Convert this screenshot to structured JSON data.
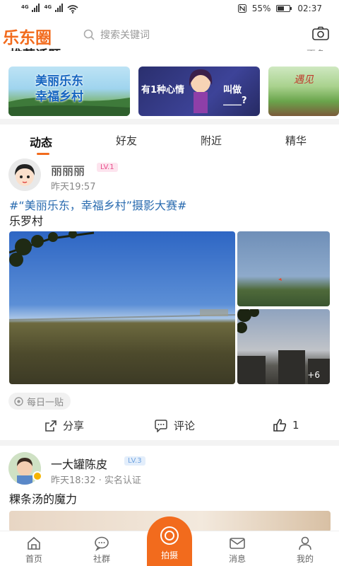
{
  "status_bar": {
    "network_left": "4G",
    "network_right": "4G",
    "battery": "55%",
    "time": "02:37"
  },
  "header": {
    "logo": "乐东圈",
    "search_placeholder": "搜索关键词",
    "icons": [
      "search-icon",
      "camera-icon"
    ]
  },
  "topics": {
    "title": "推荐话题",
    "more": "更多",
    "cards": [
      {
        "title_line1": "美丽乐东",
        "title_line2": "幸福乡村"
      },
      {
        "title": "有1种心情",
        "title2": "叫做____?"
      },
      {
        "title": "遇见"
      }
    ]
  },
  "tabs": [
    {
      "label": "动态",
      "active": true
    },
    {
      "label": "好友",
      "active": false
    },
    {
      "label": "附近",
      "active": false
    },
    {
      "label": "精华",
      "active": false
    }
  ],
  "posts": [
    {
      "user": "丽丽丽",
      "level": "LV.1",
      "time": "昨天19:57",
      "hashtag": "#“美丽乐东，幸福乡村”摄影大赛#",
      "text": "乐罗村",
      "more_photos": "+6",
      "tag": "每日一贴",
      "actions": {
        "share": "分享",
        "comment": "评论",
        "like_count": "1"
      }
    },
    {
      "user": "一大罐陈皮",
      "level": "LV.3",
      "time": "昨天18:32",
      "verified": "实名认证",
      "separator": "·",
      "text": "粿条汤的魔力"
    }
  ],
  "bottom_nav": [
    {
      "label": "首页"
    },
    {
      "label": "社群"
    },
    {
      "label": "拍摄"
    },
    {
      "label": "消息"
    },
    {
      "label": "我的"
    }
  ],
  "colors": {
    "accent": "#f26b1d",
    "hashtag": "#2b6cb0",
    "lv1": "#e84d8a",
    "lv3": "#6fa3e0"
  }
}
